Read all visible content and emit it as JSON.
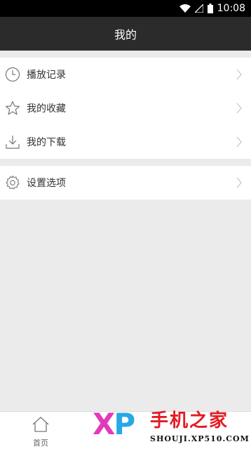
{
  "status_bar": {
    "time": "10:08"
  },
  "header": {
    "title": "我的"
  },
  "menu_primary": [
    {
      "label": "播放记录",
      "icon": "clock-icon"
    },
    {
      "label": "我的收藏",
      "icon": "star-icon"
    },
    {
      "label": "我的下载",
      "icon": "download-icon"
    }
  ],
  "menu_secondary": [
    {
      "label": "设置选项",
      "icon": "gear-icon"
    }
  ],
  "bottom_nav": {
    "home_label": "首页"
  },
  "watermark": {
    "logo": "XP",
    "title": "手机之家",
    "site": "SHOUJI.XP510.COM"
  }
}
